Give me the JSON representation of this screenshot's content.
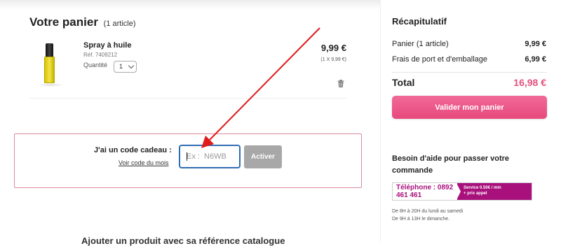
{
  "cart": {
    "title": "Votre panier",
    "count": "(1 article)",
    "product": {
      "name": "Spray à huile",
      "ref": "Réf. 7409212",
      "qty_label": "Quantité",
      "qty_value": "1",
      "price": "9,99 €",
      "price_detail": "(1 X 9,99 €)"
    }
  },
  "gift": {
    "label": "J'ai un code cadeau :",
    "link": "Voir code du mois",
    "placeholder": "Ex :  N6WB",
    "button": "Activer"
  },
  "bottom": {
    "text": "Ajouter un produit avec sa référence catalogue"
  },
  "summary": {
    "title": "Récapitulatif",
    "lines": [
      {
        "label": "Panier (1 article)",
        "value": "9,99 €"
      },
      {
        "label": "Frais de port et d'emballage",
        "value": "6,99 €"
      }
    ],
    "total_label": "Total",
    "total_value": "16,98 €",
    "button": "Valider mon panier"
  },
  "help": {
    "title": "Besoin d'aide pour passer votre commande",
    "phone": "Téléphone : 0892 461 461",
    "service": "Service 0.50€ / min",
    "service2": "+ prix appel",
    "hours1": "De 8H à 20H du lundi au samedi",
    "hours2": "De 9H à 13H le dimanche."
  },
  "colors": {
    "accent": "#e8497d",
    "phone": "#a8107c",
    "arrow": "#e01b1b"
  }
}
